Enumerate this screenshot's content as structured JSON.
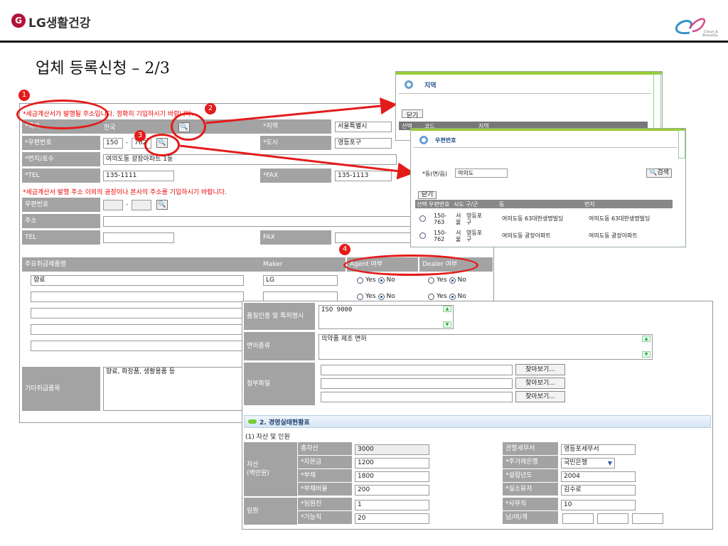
{
  "header": {
    "brand": "LG생활건강",
    "logo_glyph": "G",
    "clean_text": "Clean & Beautiful",
    "title": "업체 등록신청 – 2/3"
  },
  "annot": {
    "n1": "1",
    "n2": "2",
    "n3": "3",
    "n4": "4"
  },
  "form": {
    "notice1": "*세금계산서가 발행될 주소입니다. 정확히 기입하시기 바랍니다.",
    "country_label": "*국가",
    "country_value": "한국",
    "region_label": "*지역",
    "region_value": "서울특별시",
    "zip_label": "*우편번호",
    "zip1": "150",
    "zip2": "762",
    "city_label": "*도시",
    "city_value": "영등포구",
    "addr_label": "*번지/호수",
    "addr_value": "여의도동 광장아파트 1동",
    "tel_label": "*TEL",
    "tel_value": "135-1111",
    "fax_label": "*FAX",
    "fax_value": "135-1113",
    "notice2": "*세금계산서 발행 주소 이외의 공장이나 본사의 주소를 기입하시기 바랍니다.",
    "zip_label2": "우편번호",
    "zip_dash": "-",
    "addr_label2": "주소",
    "tel_label2": "TEL",
    "fax_label2": "FAX",
    "prod_header": "주요취급제품명",
    "maker_header": "Maker",
    "agent_header": "Agent 여부",
    "dealer_header": "Dealer 여부",
    "prod1": "향료",
    "maker1": "LG",
    "yes": "Yes",
    "no": "No",
    "etc_label": "기타취급품목",
    "etc_value": "향료, 화장품, 생활용품 등"
  },
  "region_popup": {
    "title": "지역",
    "close": "닫기",
    "col_select": "선택",
    "col_code": "코드",
    "col_region": "지역"
  },
  "zip_popup": {
    "title": "우편번호",
    "dong_label": "*동(면/읍)",
    "dong_value": "여의도",
    "search": "검색",
    "close": "닫기",
    "cols": [
      "선택",
      "우편번호",
      "시도",
      "구/군",
      "동",
      "번지"
    ],
    "rows": [
      {
        "zip": "150-763",
        "sido": "서울",
        "gu": "영등포구",
        "dong": "여의도동 63대한생명빌딩",
        "bunji": "여의도동 63대한생명빌딩"
      },
      {
        "zip": "150-762",
        "sido": "서울",
        "gu": "영등포구",
        "dong": "여의도동 광장아파트",
        "bunji": "여의도동 광장아파트"
      }
    ]
  },
  "detail": {
    "cert_label": "품질인증 및 특허명시",
    "cert_value": "ISO 9000",
    "license_label": "면허종류",
    "license_value": "의약품 제조 면허",
    "attach_label": "첨부파일",
    "browse": "찾아보기...",
    "section2": "2. 경영실태현황표",
    "sub1": "(1) 자산 및 인원",
    "asset_label": "자산\n(백만원)",
    "total_asset": "총자산",
    "total_asset_v": "3000",
    "capital": "*자본금",
    "capital_v": "1200",
    "debt": "*부채",
    "debt_v": "1800",
    "debt_ratio": "*부채비율",
    "debt_ratio_v": "200",
    "tax_office": "관할세무서",
    "tax_office_v": "영등포세무서",
    "bank": "*주거래은행",
    "bank_v": "국민은행",
    "est_year": "*설립년도",
    "est_year_v": "2004",
    "owner": "*실소유자",
    "owner_v": "김수로",
    "staff_label": "임원",
    "exec": "*임원진",
    "exec_v": "1",
    "tech": "*기능직",
    "tech_v": "20",
    "office": "*사무직",
    "office_v": "10",
    "gender": "남/여/계"
  }
}
